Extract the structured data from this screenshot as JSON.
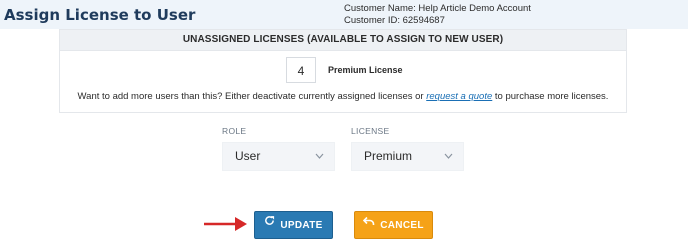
{
  "header": {
    "title": "Assign License to User",
    "customer_name": "Customer Name: Help Article Demo Account",
    "customer_id": "Customer ID: 62594687"
  },
  "licenses": {
    "heading": "UNASSIGNED LICENSES (AVAILABLE TO ASSIGN TO NEW USER)",
    "count": "4",
    "name": "Premium License",
    "notice_prefix": "Want to add more users than this? Either deactivate currently assigned licenses or",
    "notice_link": "request a quote",
    "notice_suffix": "to purchase more licenses."
  },
  "form": {
    "role_label": "ROLE",
    "role_value": "User",
    "license_label": "LICENSE",
    "license_value": "Premium"
  },
  "actions": {
    "update_label": "UPDATE",
    "cancel_label": "CANCEL"
  },
  "colors": {
    "update": "#2a7ab3",
    "cancel": "#f5a218",
    "arrow": "#d62828",
    "title": "#1f3b5c"
  },
  "icons": [
    "refresh-icon",
    "undo-icon",
    "arrow-right-icon",
    "chevron-down-icon"
  ]
}
